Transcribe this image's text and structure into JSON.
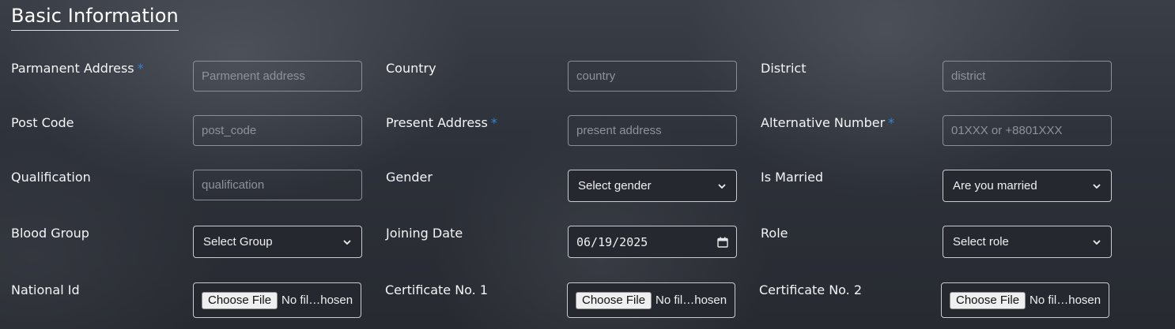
{
  "section": {
    "title": "Basic Information"
  },
  "required_marker": "*",
  "fields": {
    "permanent_address": {
      "label": "Parmanent Address",
      "placeholder": "Parmenent address"
    },
    "country": {
      "label": "Country",
      "placeholder": "country"
    },
    "district": {
      "label": "District",
      "placeholder": "district"
    },
    "post_code": {
      "label": "Post Code",
      "placeholder": "post_code"
    },
    "present_address": {
      "label": "Present Address",
      "placeholder": "present address"
    },
    "alternative_number": {
      "label": "Alternative Number",
      "placeholder": "01XXX or +8801XXX"
    },
    "qualification": {
      "label": "Qualification",
      "placeholder": "qualification"
    },
    "gender": {
      "label": "Gender",
      "selected": "Select gender"
    },
    "is_married": {
      "label": "Is Married",
      "selected": "Are you married"
    },
    "blood_group": {
      "label": "Blood Group",
      "selected": "Select Group"
    },
    "joining_date": {
      "label": "Joining Date",
      "value": "06/19/2025"
    },
    "role": {
      "label": "Role",
      "selected": "Select role"
    },
    "national_id": {
      "label": "National Id",
      "button": "Choose File",
      "file_status": "No fil…hosen"
    },
    "certificate_1": {
      "label": "Certificate No. 1",
      "button": "Choose File",
      "file_status": "No fil…hosen"
    },
    "certificate_2": {
      "label": "Certificate No. 2",
      "button": "Choose File",
      "file_status": "No fil…hosen"
    }
  },
  "icons": {
    "select": "chevron-down-icon",
    "date": "calendar-icon"
  }
}
